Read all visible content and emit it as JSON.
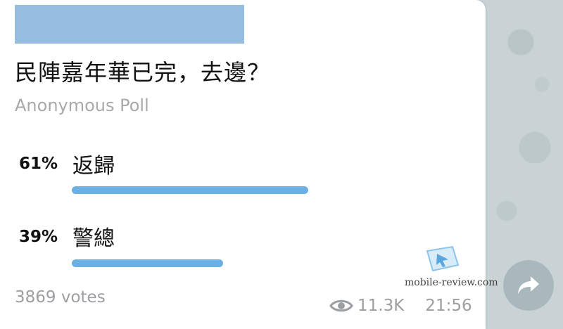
{
  "poll": {
    "question": "民陣嘉年華已完，去邊？",
    "type": "Anonymous Poll",
    "options": [
      {
        "percent": "61%",
        "label": "返歸",
        "fraction": 0.61
      },
      {
        "percent": "39%",
        "label": "警總",
        "fraction": 0.39
      }
    ],
    "votes": "3869 votes",
    "views": "11.3K",
    "time": "21:56",
    "bar_color": "#6bb0e3"
  },
  "watermark": {
    "text": "mobile-review.com",
    "icon": "mobile-review-logo-icon"
  },
  "share": {
    "icon": "share-arrow-icon"
  }
}
